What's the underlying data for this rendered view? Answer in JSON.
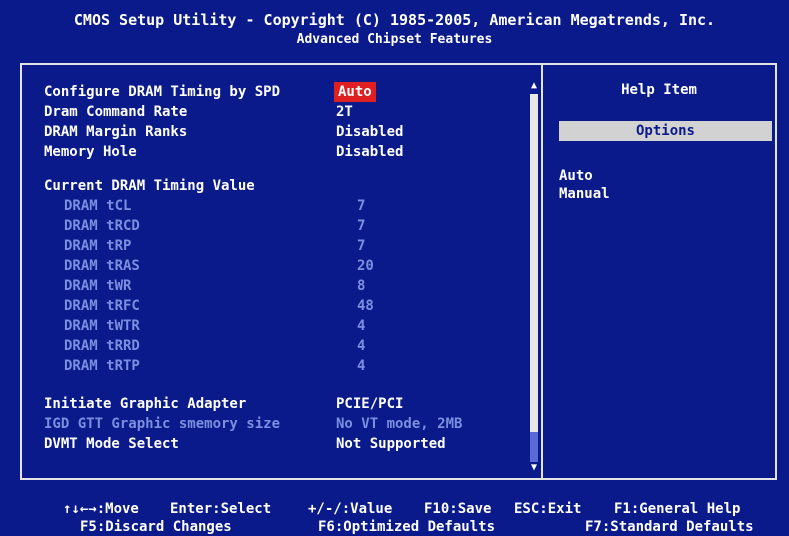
{
  "header": {
    "title": "CMOS Setup Utility - Copyright (C) 1985-2005, American Megatrends, Inc.",
    "subtitle": "Advanced Chipset Features"
  },
  "menu": {
    "configure_dram": {
      "label": "Configure DRAM Timing by SPD",
      "value": "Auto"
    },
    "dram_command_rate": {
      "label": "Dram Command Rate",
      "value": "2T"
    },
    "dram_margin_ranks": {
      "label": "DRAM Margin Ranks",
      "value": "Disabled"
    },
    "memory_hole": {
      "label": "Memory Hole",
      "value": "Disabled"
    },
    "current_timing_header": "Current DRAM Timing Value",
    "timings": [
      {
        "label": "DRAM tCL",
        "value": "7"
      },
      {
        "label": "DRAM tRCD",
        "value": "7"
      },
      {
        "label": "DRAM tRP",
        "value": "7"
      },
      {
        "label": "DRAM tRAS",
        "value": "20"
      },
      {
        "label": "DRAM tWR",
        "value": "8"
      },
      {
        "label": "DRAM tRFC",
        "value": "48"
      },
      {
        "label": "DRAM tWTR",
        "value": "4"
      },
      {
        "label": "DRAM tRRD",
        "value": "4"
      },
      {
        "label": "DRAM tRTP",
        "value": "4"
      }
    ],
    "initiate_graphic_adapter": {
      "label": "Initiate Graphic Adapter",
      "value": "PCIE/PCI"
    },
    "igd_gtt": {
      "label": "IGD GTT Graphic smemory size",
      "value": "No VT mode, 2MB"
    },
    "dvmt_mode": {
      "label": "DVMT Mode Select",
      "value": "Not Supported"
    }
  },
  "help": {
    "title": "Help Item",
    "options_header": "Options",
    "options": [
      "Auto",
      "Manual"
    ]
  },
  "footer": {
    "move": "↑↓←→:Move",
    "select": "Enter:Select",
    "value": "+/-/:Value",
    "save": "F10:Save",
    "exit": "ESC:Exit",
    "general_help": "F1:General Help",
    "discard": "F5:Discard Changes",
    "optimized": "F6:Optimized Defaults",
    "standard": "F7:Standard Defaults"
  },
  "colors": {
    "background": "#0a1a8a",
    "selected": "#e02020",
    "disabled_text": "#7a8fe0"
  }
}
